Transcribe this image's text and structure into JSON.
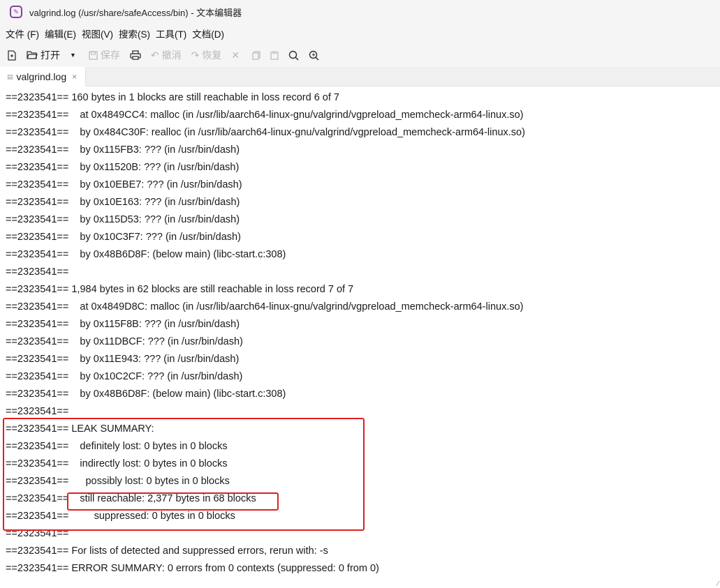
{
  "window": {
    "title": "valgrind.log (/usr/share/safeAccess/bin) - 文本编辑器"
  },
  "menu": [
    "文件 (F)",
    "编辑(E)",
    "视图(V)",
    "搜索(S)",
    "工具(T)",
    "文档(D)"
  ],
  "toolbar": {
    "open_label": "打开",
    "save_label": "保存",
    "undo_label": "撤消",
    "redo_label": "恢复"
  },
  "tab": {
    "label": "valgrind.log",
    "close": "×"
  },
  "editor": {
    "lines": [
      "==2323541== 160 bytes in 1 blocks are still reachable in loss record 6 of 7",
      "==2323541==    at 0x4849CC4: malloc (in /usr/lib/aarch64-linux-gnu/valgrind/vgpreload_memcheck-arm64-linux.so)",
      "==2323541==    by 0x484C30F: realloc (in /usr/lib/aarch64-linux-gnu/valgrind/vgpreload_memcheck-arm64-linux.so)",
      "==2323541==    by 0x115FB3: ??? (in /usr/bin/dash)",
      "==2323541==    by 0x11520B: ??? (in /usr/bin/dash)",
      "==2323541==    by 0x10EBE7: ??? (in /usr/bin/dash)",
      "==2323541==    by 0x10E163: ??? (in /usr/bin/dash)",
      "==2323541==    by 0x115D53: ??? (in /usr/bin/dash)",
      "==2323541==    by 0x10C3F7: ??? (in /usr/bin/dash)",
      "==2323541==    by 0x48B6D8F: (below main) (libc-start.c:308)",
      "==2323541==",
      "==2323541== 1,984 bytes in 62 blocks are still reachable in loss record 7 of 7",
      "==2323541==    at 0x4849D8C: malloc (in /usr/lib/aarch64-linux-gnu/valgrind/vgpreload_memcheck-arm64-linux.so)",
      "==2323541==    by 0x115F8B: ??? (in /usr/bin/dash)",
      "==2323541==    by 0x11DBCF: ??? (in /usr/bin/dash)",
      "==2323541==    by 0x11E943: ??? (in /usr/bin/dash)",
      "==2323541==    by 0x10C2CF: ??? (in /usr/bin/dash)",
      "==2323541==    by 0x48B6D8F: (below main) (libc-start.c:308)",
      "==2323541==",
      "==2323541== LEAK SUMMARY:",
      "==2323541==    definitely lost: 0 bytes in 0 blocks",
      "==2323541==    indirectly lost: 0 bytes in 0 blocks",
      "==2323541==      possibly lost: 0 bytes in 0 blocks",
      "==2323541==    still reachable: 2,377 bytes in 68 blocks",
      "==2323541==         suppressed: 0 bytes in 0 blocks",
      "==2323541==",
      "==2323541== For lists of detected and suppressed errors, rerun with: -s",
      "==2323541== ERROR SUMMARY: 0 errors from 0 contexts (suppressed: 0 from 0)"
    ]
  },
  "colors": {
    "annotation": "#e02020",
    "chrome_bg": "#f5f5f5",
    "disabled": "#b9b9b9"
  }
}
